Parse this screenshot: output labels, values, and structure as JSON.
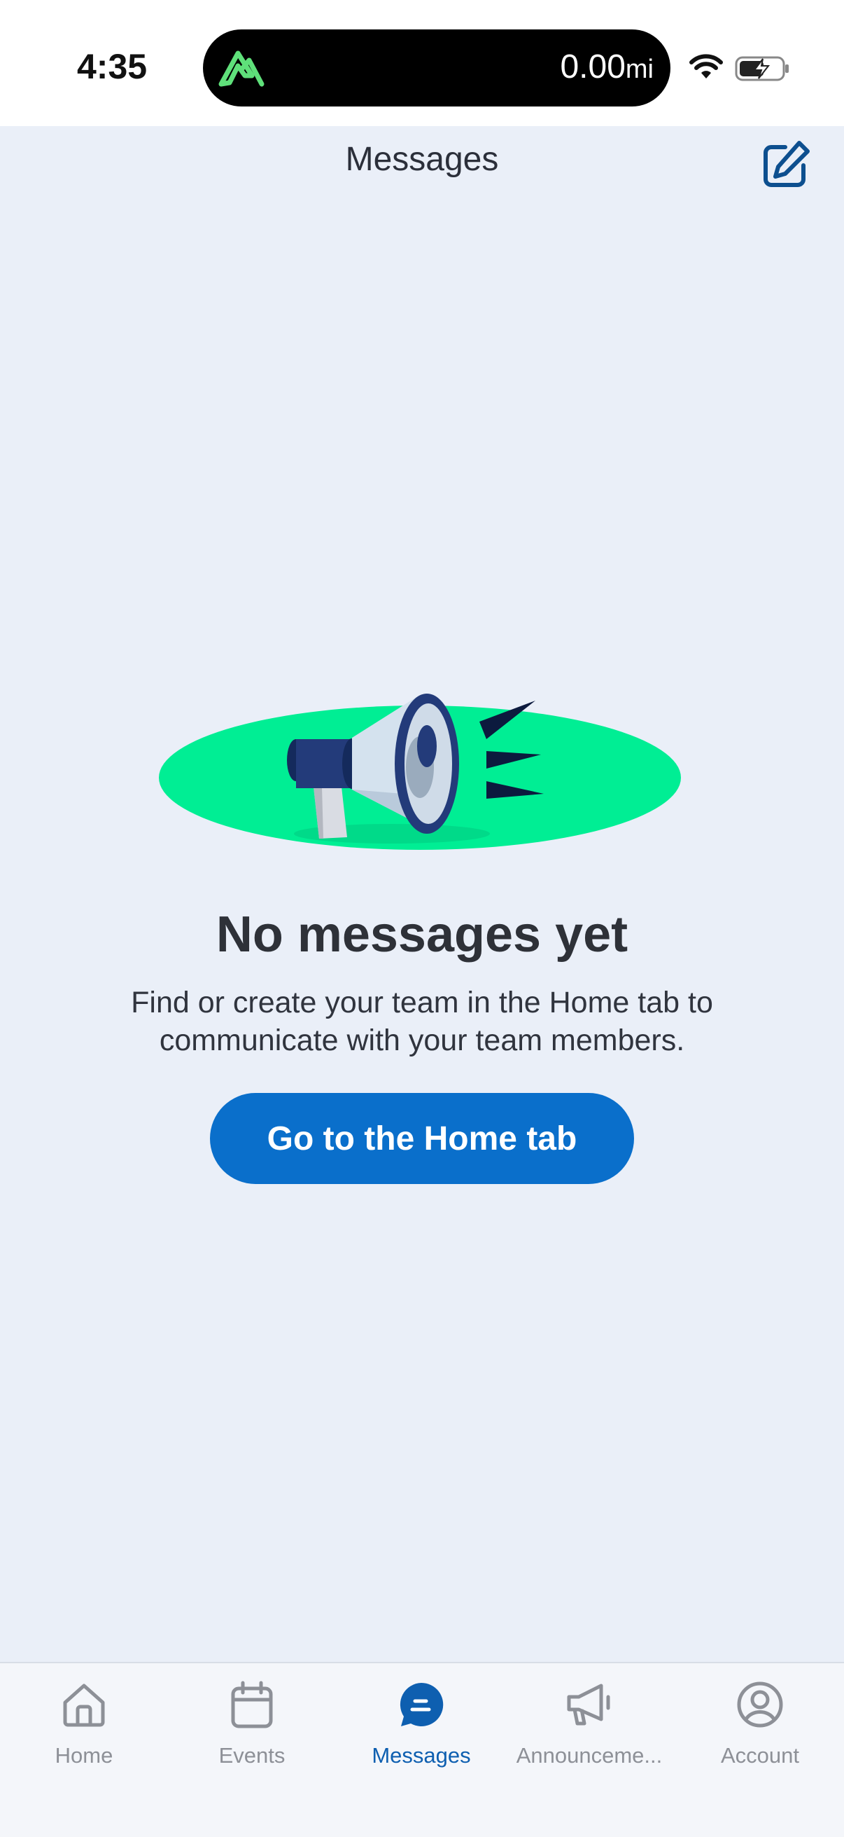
{
  "status_bar": {
    "time": "4:35",
    "distance_value": "0.00",
    "distance_unit": "mi",
    "icons": [
      "app-logo-icon",
      "wifi-icon",
      "battery-charging-icon"
    ]
  },
  "header": {
    "title": "Messages",
    "compose_icon": "compose-icon"
  },
  "empty_state": {
    "illustration": "megaphone-illustration",
    "title": "No messages yet",
    "body_line1": "Find or create your team in the Home tab to",
    "body_line2": "communicate with your team members.",
    "button_label": "Go to the Home tab"
  },
  "tabs": [
    {
      "label": "Home",
      "icon": "home-icon",
      "active": false
    },
    {
      "label": "Events",
      "icon": "calendar-icon",
      "active": false
    },
    {
      "label": "Messages",
      "icon": "chat-bubble-icon",
      "active": true
    },
    {
      "label": "Announceme...",
      "icon": "megaphone-icon",
      "active": false
    },
    {
      "label": "Account",
      "icon": "user-circle-icon",
      "active": false
    }
  ],
  "colors": {
    "accent": "#0a6fcb",
    "active_tab": "#0e5fb0",
    "background": "#eaeff8",
    "illustration_green": "#00ee94",
    "inactive_tab": "#8d9097"
  }
}
